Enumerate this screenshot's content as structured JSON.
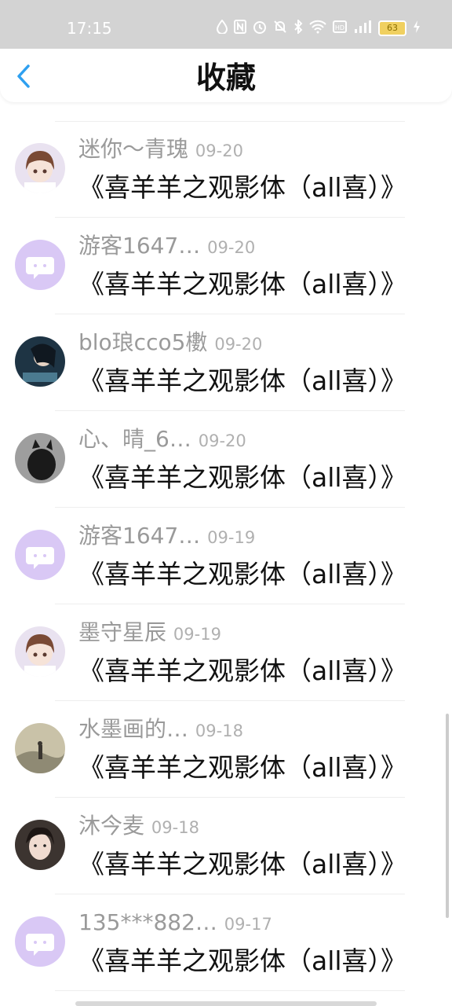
{
  "status_bar": {
    "time": "17:15",
    "icons": [
      "water-drop-icon",
      "nfc-icon",
      "alarm-icon",
      "mute-icon",
      "bluetooth-icon",
      "wifi-icon",
      "hd-icon",
      "signal-icon"
    ],
    "battery": "63"
  },
  "header": {
    "title": "收藏",
    "back_glyph": "‹"
  },
  "favorites": [
    {
      "name": "迷你～青瑰",
      "date": "09-20",
      "text": "《喜羊羊之观影体（all喜）》",
      "avatar": "anime-girl-avatar"
    },
    {
      "name": "游客1647…",
      "date": "09-20",
      "text": "《喜羊羊之观影体（all喜）》",
      "avatar": "default-chat-avatar"
    },
    {
      "name": "blo琅cco5櫢",
      "date": "09-20",
      "text": "《喜羊羊之观影体（all喜）》",
      "avatar": "character-portrait-avatar"
    },
    {
      "name": "心、晴_6…",
      "date": "09-20",
      "text": "《喜羊羊之观影体（all喜）》",
      "avatar": "black-cat-avatar"
    },
    {
      "name": "游客1647…",
      "date": "09-19",
      "text": "《喜羊羊之观影体（all喜）》",
      "avatar": "default-chat-avatar"
    },
    {
      "name": "墨守星辰",
      "date": "09-19",
      "text": "《喜羊羊之观影体（all喜）》",
      "avatar": "anime-girl-avatar"
    },
    {
      "name": "水墨画的…",
      "date": "09-18",
      "text": "《喜羊羊之观影体（all喜）》",
      "avatar": "ink-landscape-avatar"
    },
    {
      "name": "沐今麦",
      "date": "09-18",
      "text": "《喜羊羊之观影体（all喜）》",
      "avatar": "portrait-girl-avatar"
    },
    {
      "name": "135***882…",
      "date": "09-17",
      "text": "《喜羊羊之观影体（all喜）》",
      "avatar": "default-chat-avatar"
    }
  ],
  "colors": {
    "accent": "#2ea0f0",
    "status_bar_bg": "#d3d3d3",
    "default_avatar_bg": "#d9c8f5",
    "name_text": "#9a9a9a"
  }
}
